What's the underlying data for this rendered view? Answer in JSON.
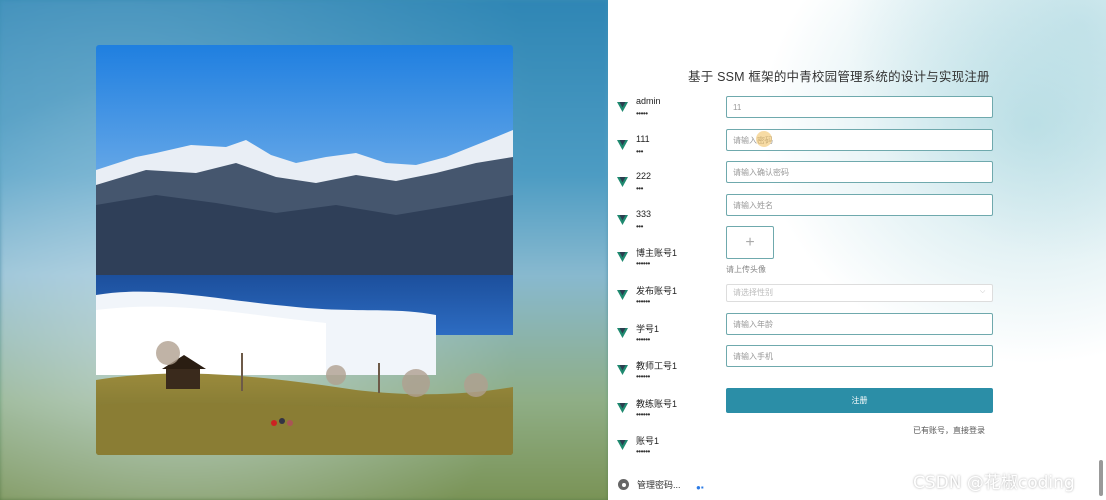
{
  "form": {
    "title": "基于 SSM 框架的中青校园管理系统的设计与实现注册",
    "username_value": "11",
    "password_placeholder": "请输入密码",
    "confirm_placeholder": "请输入确认密码",
    "name_placeholder": "请输入姓名",
    "upload_plus": "+",
    "upload_hint": "请上传头像",
    "gender_placeholder": "请选择性别",
    "age_placeholder": "请输入年龄",
    "phone_placeholder": "请输入手机",
    "submit_label": "注册",
    "login_link": "已有账号，直接登录"
  },
  "autocomplete": {
    "items": [
      {
        "user": "admin",
        "pass": "•••••"
      },
      {
        "user": "111",
        "pass": "•••"
      },
      {
        "user": "222",
        "pass": "•••"
      },
      {
        "user": "333",
        "pass": "•••"
      },
      {
        "user": "博主账号1",
        "pass": "••••••"
      },
      {
        "user": "发布账号1",
        "pass": "••••••"
      },
      {
        "user": "学号1",
        "pass": "••••••"
      },
      {
        "user": "教师工号1",
        "pass": "••••••"
      },
      {
        "user": "教练账号1",
        "pass": "••••••"
      },
      {
        "user": "账号1",
        "pass": "••••••"
      }
    ],
    "manage_label": "管理密码..."
  },
  "watermark": "CSDN @花椒coding",
  "colors": {
    "accent": "#2b8ea7",
    "field_border": "#6fa9ad",
    "vue_green": "#1f8a70"
  }
}
